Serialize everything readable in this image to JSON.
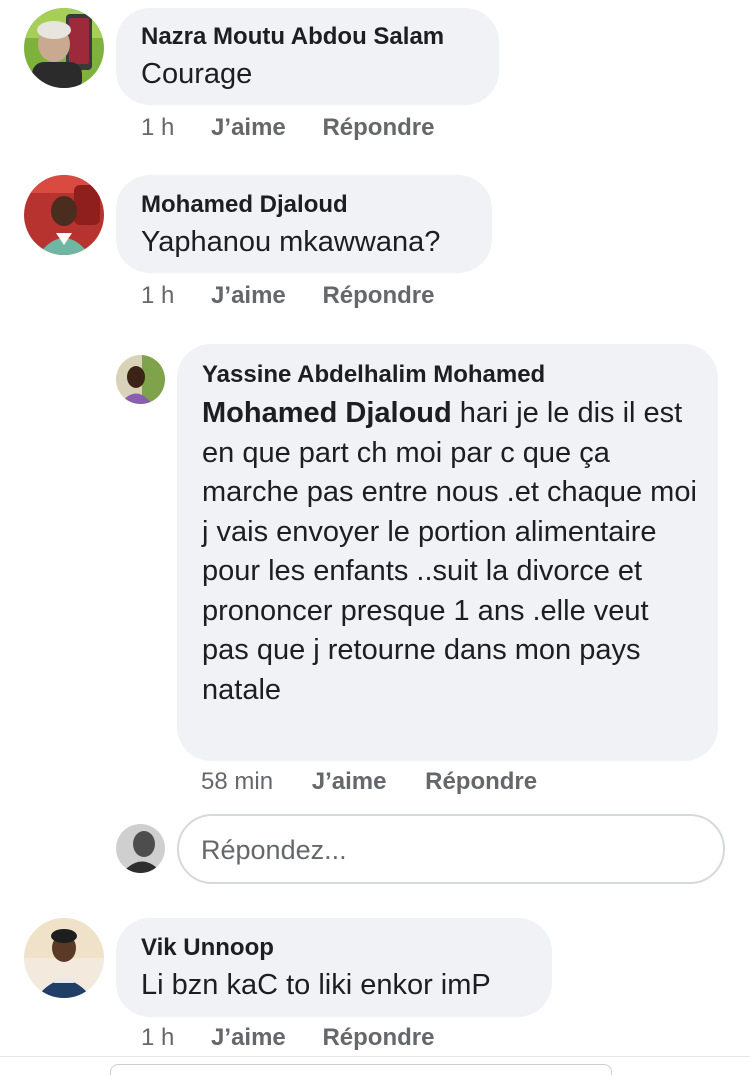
{
  "comments": [
    {
      "author": "Nazra Moutu Abdou Salam",
      "text": "Courage",
      "time": "1 h",
      "like_label": "J’aime",
      "reply_label": "Répondre"
    },
    {
      "author": "Mohamed Djaloud",
      "text": "Yaphanou mkawwana?",
      "time": "1 h",
      "like_label": "J’aime",
      "reply_label": "Répondre",
      "replies": [
        {
          "author": "Yassine Abdelhalim Mohamed",
          "mention": "Mohamed Djaloud",
          "text": " hari je le dis il est en que  part ch moi par c que ça marche pas entre nous .et chaque moi j vais  envoyer le portion alimentaire pour  les enfants ..suit la divorce et prononcer presque 1 ans  .elle veut pas que j retourne dans  mon pays  natale",
          "time": "58 min",
          "like_label": "J’aime",
          "reply_label": "Répondre"
        }
      ]
    },
    {
      "author": "Vik Unnoop",
      "text": "Li bzn kaC to liki enkor imP",
      "time": "1 h",
      "like_label": "J’aime",
      "reply_label": "Répondre"
    }
  ],
  "reply_box": {
    "placeholder": "Répondez..."
  },
  "colors": {
    "bubble": "#f0f2f5",
    "text": "#1c1e21",
    "meta": "#65676b",
    "input_border": "#d5d8dd"
  }
}
